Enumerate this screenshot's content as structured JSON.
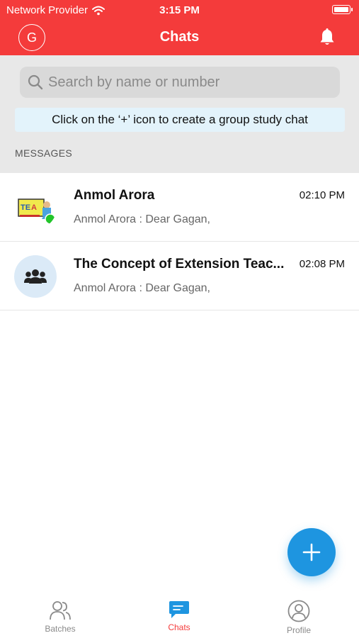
{
  "status_bar": {
    "carrier": "Network Provider",
    "time": "3:15 PM"
  },
  "nav": {
    "avatar_initial": "G",
    "title": "Chats"
  },
  "search": {
    "placeholder": "Search by name or number"
  },
  "tip": {
    "text": "Click on the ‘+’ icon to create a group study chat"
  },
  "messages": {
    "section_label": "MESSAGES",
    "items": [
      {
        "name": "Anmol Arora",
        "time": "02:10 PM",
        "preview": "Anmol Arora : Dear Gagan,",
        "avatar": "photo",
        "online": true
      },
      {
        "name": "The Concept of Extension Teac...",
        "time": "02:08 PM",
        "preview": "Anmol Arora : Dear Gagan,",
        "avatar": "group-icon",
        "online": false
      }
    ]
  },
  "fab": {
    "icon": "plus-icon"
  },
  "tabs": [
    {
      "label": "Batches",
      "icon": "users-icon",
      "active": false
    },
    {
      "label": "Chats",
      "icon": "chat-bubble-icon",
      "active": true
    },
    {
      "label": "Profile",
      "icon": "profile-icon",
      "active": false
    }
  ],
  "colors": {
    "brand_red": "#f43b3b",
    "accent_blue": "#1e95e0",
    "tip_bg": "#e3f3fb",
    "panel_gray": "#e8e8e8"
  }
}
